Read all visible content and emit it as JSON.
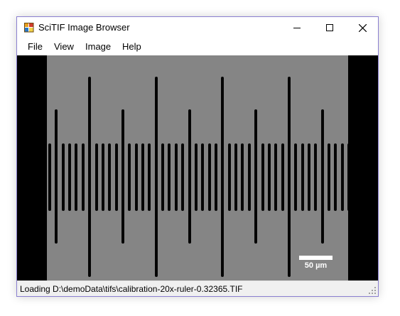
{
  "window": {
    "title": "SciTIF Image Browser"
  },
  "menu": [
    {
      "label": "File"
    },
    {
      "label": "View"
    },
    {
      "label": "Image"
    },
    {
      "label": "Help"
    }
  ],
  "image": {
    "scale_bar_label": "50 µm",
    "ticks_visible": true
  },
  "status": {
    "text": "Loading D:\\demoData\\tifs\\calibration-20x-ruler-0.32365.TIF"
  },
  "colors": {
    "image_background": "#858585",
    "ruler_tick": "#050505",
    "viewport_background": "#000000",
    "status_background": "#f0f0f0",
    "window_border": "#8a7fd0"
  },
  "icons": {
    "app": "tif-app-icon",
    "minimize": "minimize-icon",
    "maximize": "maximize-icon",
    "close": "close-icon",
    "resize": "resize-grip-icon"
  }
}
